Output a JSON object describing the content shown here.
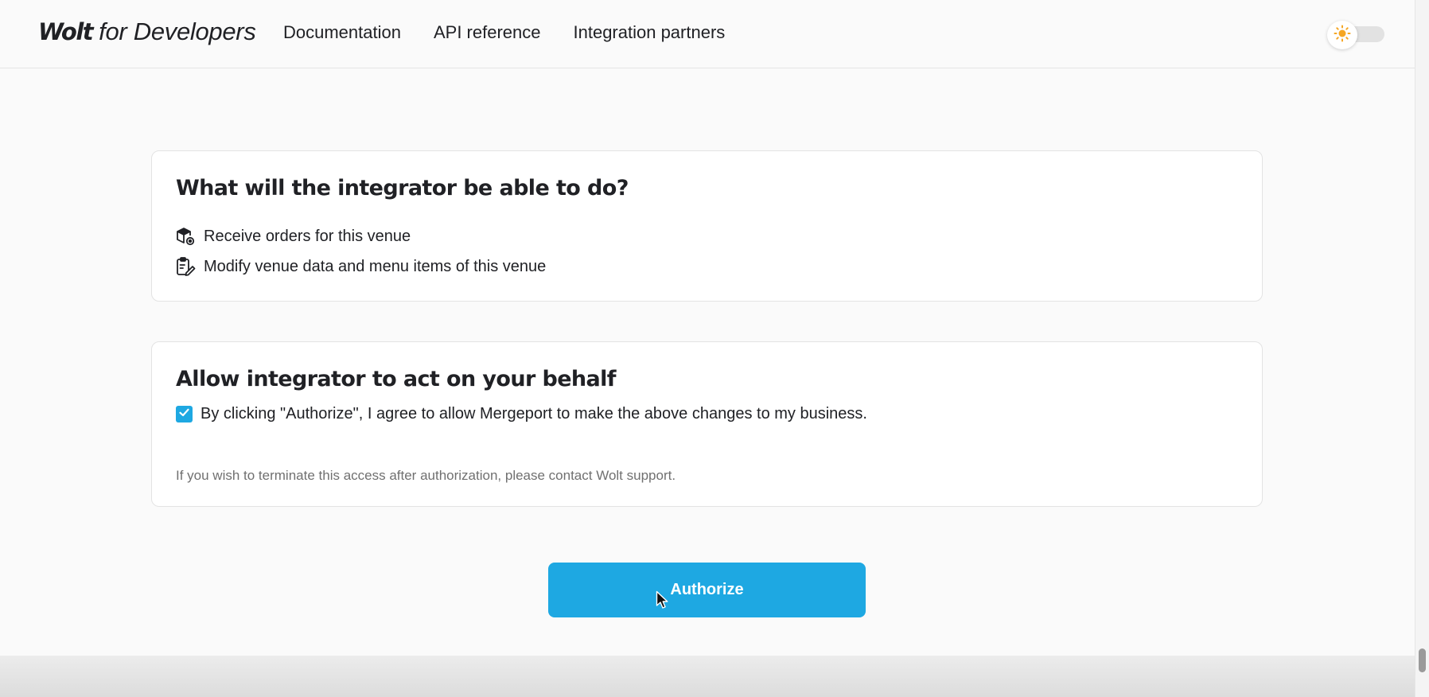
{
  "header": {
    "brand_primary": "Wolt",
    "brand_secondary": "for Developers",
    "nav": [
      {
        "label": "Documentation"
      },
      {
        "label": "API reference"
      },
      {
        "label": "Integration partners"
      }
    ],
    "theme_toggle_icon": "sun-icon"
  },
  "capabilities": {
    "title": "What will the integrator be able to do?",
    "items": [
      {
        "icon": "package-icon",
        "label": "Receive orders for this venue"
      },
      {
        "icon": "clipboard-edit-icon",
        "label": "Modify venue data and menu items of this venue"
      }
    ]
  },
  "consent": {
    "title": "Allow integrator to act on your behalf",
    "checkbox_label": "By clicking \"Authorize\", I agree to allow Mergeport to make the above changes to my business.",
    "checked": true,
    "note": "If you wish to terminate this access after authorization, please contact Wolt support."
  },
  "actions": {
    "authorize_label": "Authorize"
  },
  "colors": {
    "accent": "#1ea8e2",
    "text": "#202125",
    "muted": "#707070",
    "sun": "#f5a623"
  }
}
